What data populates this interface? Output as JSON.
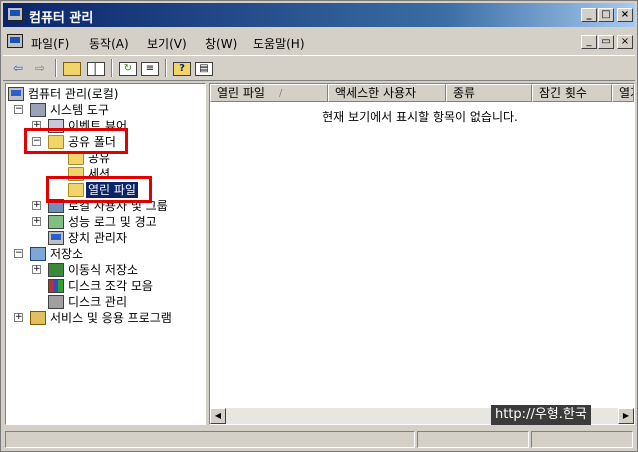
{
  "window": {
    "title": "컴퓨터 관리"
  },
  "title_buttons": {
    "minimize": "_",
    "maximize": "□",
    "close": "×"
  },
  "menu": [
    "파일(F)",
    "동작(A)",
    "보기(V)",
    "창(W)",
    "도움말(H)"
  ],
  "mdi_buttons": {
    "minimize": "_",
    "restore": "▭",
    "close": "×"
  },
  "toolbar_icons": [
    "back-arrow-icon",
    "forward-arrow-icon",
    "up-folder-icon",
    "show-hide-tree-icon",
    "refresh-icon",
    "export-list-icon",
    "help-icon",
    "properties-icon"
  ],
  "tree": {
    "root": "컴퓨터 관리(로컬)",
    "system_tools": "시스템 도구",
    "event_viewer": "이벤트 뷰어",
    "shared_folders": "공유 폴더",
    "shares": "공유",
    "sessions": "세션",
    "open_files": "열린 파일",
    "local_users": "로컬 사용자 및 그룹",
    "perf_logs": "성능 로그 및 경고",
    "device_manager": "장치 관리자",
    "storage": "저장소",
    "removable": "이동식 저장소",
    "defrag": "디스크 조각 모음",
    "disk_mgmt": "디스크 관리",
    "services": "서비스 및 응용 프로그램"
  },
  "list": {
    "columns": [
      "열린 파일",
      "액세스한 사용자",
      "종류",
      "잠긴 횟수",
      "열기"
    ],
    "sort_indicator": "/",
    "empty_message": "현재 보기에서 표시할 항목이 없습니다."
  },
  "watermark": "http://우형.한국",
  "colors": {
    "title_start": "#0a246a",
    "title_end": "#a6caf0",
    "highlight_box": "#e00000",
    "selection": "#0a246a"
  }
}
